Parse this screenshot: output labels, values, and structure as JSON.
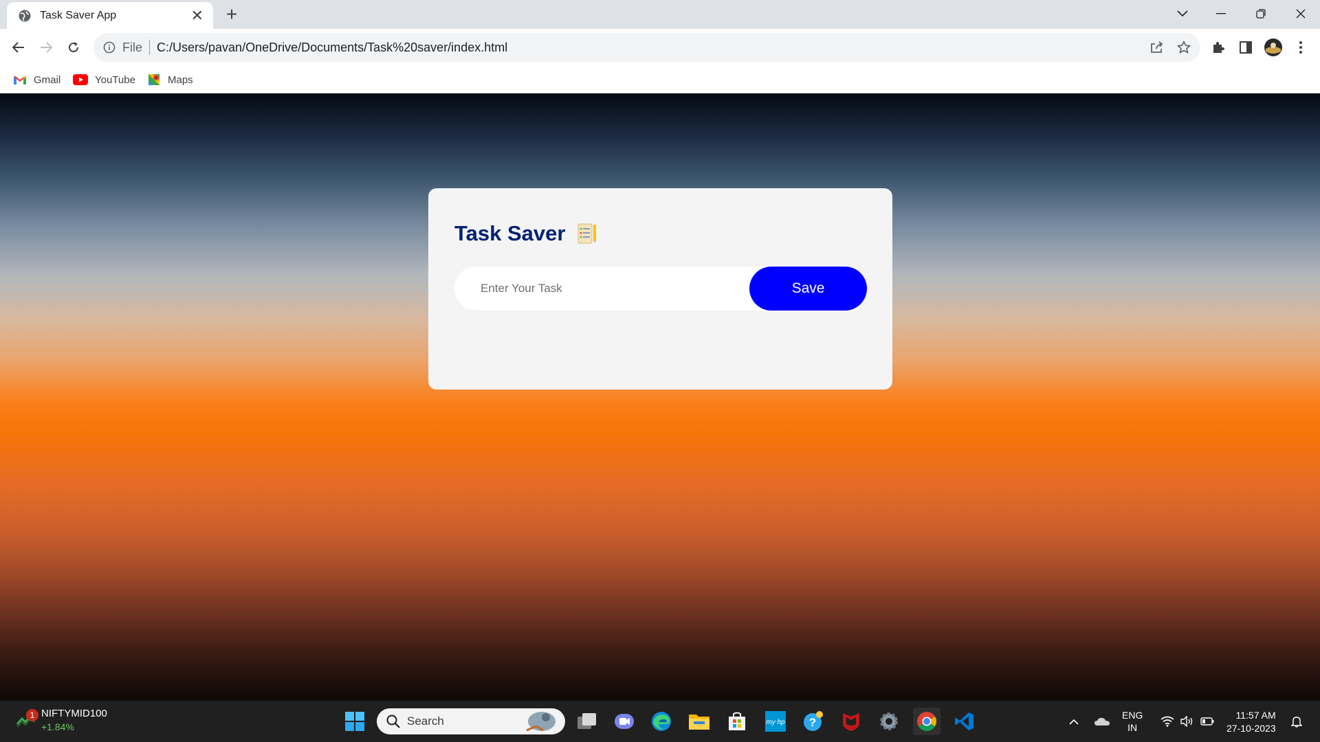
{
  "browser": {
    "tab_title": "Task Saver App",
    "new_tab_label": "+",
    "scheme_label": "File",
    "url": "C:/Users/pavan/OneDrive/Documents/Task%20saver/index.html",
    "bookmarks": [
      {
        "label": "Gmail",
        "icon": "gmail-icon"
      },
      {
        "label": "YouTube",
        "icon": "youtube-icon"
      },
      {
        "label": "Maps",
        "icon": "maps-icon"
      }
    ]
  },
  "app": {
    "title": "Task Saver",
    "title_emoji": "notepad-icon",
    "input_placeholder": "Enter Your Task",
    "input_value": "",
    "save_label": "Save",
    "colors": {
      "title": "#002272",
      "button": "#0000ff",
      "card": "#f4f4f5"
    }
  },
  "taskbar": {
    "stock_name": "NIFTYMID100",
    "stock_change": "+1.84%",
    "stock_badge": "1",
    "search_label": "Search",
    "lang_top": "ENG",
    "lang_bottom": "IN",
    "time": "11:57 AM",
    "date": "27-10-2023"
  }
}
